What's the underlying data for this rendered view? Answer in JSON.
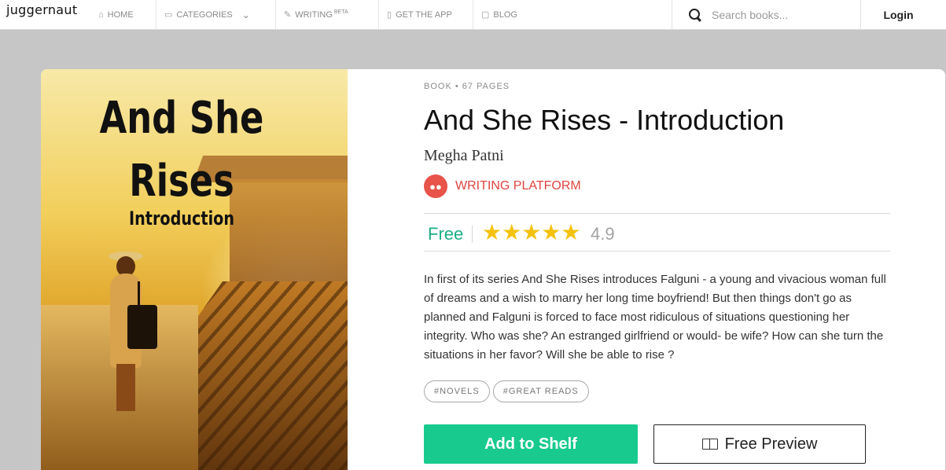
{
  "nav": {
    "logo": "juggernaut",
    "home": "HOME",
    "categories": "CATEGORIES",
    "writing": "WRITING",
    "writing_badge": "BETA",
    "app": "GET THE APP",
    "blog": "BLOG",
    "search_placeholder": "Search books...",
    "login": "Login"
  },
  "cover": {
    "line1": "And She",
    "line2": "Rises",
    "line3": "Introduction"
  },
  "book": {
    "meta": "BOOK • 67 PAGES",
    "title": "And She Rises - Introduction",
    "author": "Megha Patni",
    "platform": "WRITING PLATFORM",
    "price": "Free",
    "stars": "★★★★★",
    "rating": "4.9",
    "description": "In first of its series And She Rises introduces Falguni - a young and vivacious woman full of dreams and a wish to marry her long time boyfriend! But then things don't go as planned and Falguni is forced to face most ridiculous of situations questioning her integrity. Who was she? An estranged girlfriend or would- be wife? How can she turn the situations in her favor? Will she be able to rise ?",
    "tags": [
      "#NOVELS",
      "#GREAT READS"
    ],
    "add_to_shelf": "Add to Shelf",
    "free_preview": "Free Preview"
  },
  "colors": {
    "accent_green": "#19ca8f",
    "price_green": "#1cae85",
    "platform_red": "#e0443e",
    "star_yellow": "#f4c20d"
  }
}
